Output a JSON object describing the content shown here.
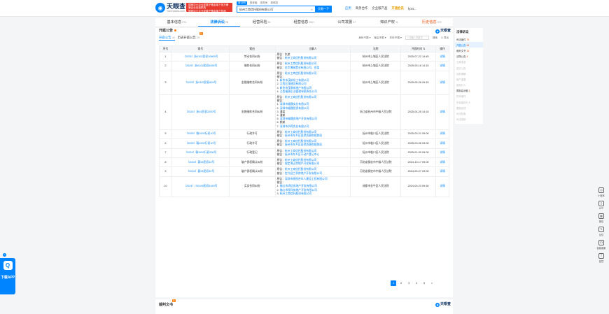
{
  "header": {
    "logo_text": "天眼查",
    "logo_sub": "TianYancha.com",
    "promo_line1": "国家中小企业发展子基金旗下官方备案企业征信机构",
    "promo_line2": "国家中小企业发展子基金旗下机构",
    "search_tabs": [
      "查公司",
      "查老板",
      "查关系",
      "查风险"
    ],
    "search_value": "杭州工商信托股份有限公司",
    "search_button": "天眼一下",
    "nav": [
      "应用",
      "商务合作",
      "企业版产品",
      "开通会员",
      "fyx4..."
    ]
  },
  "tabs": [
    {
      "label": "基本信息",
      "count": "274"
    },
    {
      "label": "法律诉讼",
      "count": "79"
    },
    {
      "label": "经营风险",
      "count": "81"
    },
    {
      "label": "经营信息",
      "count": "999+"
    },
    {
      "label": "公司发展",
      "count": "37"
    },
    {
      "label": "知识产权",
      "count": "11"
    },
    {
      "label": "历史信息",
      "count": "379"
    }
  ],
  "section": {
    "title": "开庭公告",
    "brand": "天眼查",
    "subtabs": [
      {
        "label": "开庭公告",
        "count": "44"
      },
      {
        "label": "历史开庭公告",
        "count": "29"
      }
    ],
    "new_badge": "新",
    "filters": [
      "身份不限",
      "案由不限",
      "年份不限"
    ],
    "search_placeholder": "请输入关键词",
    "search_btn": "搜索",
    "export": "导出"
  },
  "table": {
    "headers": [
      "序号",
      "案号",
      "案由",
      "当事人",
      "法院",
      "开庭时间",
      "操作"
    ],
    "rows": [
      {
        "no": "1",
        "case_no": "（2025）浙0102民初10805号",
        "cause": "劳动合同纠纷",
        "parties": [
          [
            "原告：",
            "仇某",
            "plain"
          ],
          [
            "被告：",
            "杭州工商信托股份有限公司",
            "link"
          ]
        ],
        "court": "杭州市上城区人民法院",
        "time": "2025-07-22 14:45",
        "op": "详情"
      },
      {
        "no": "2",
        "case_no": "（2025）浙0102民初5455号",
        "cause": "借款合同纠纷",
        "parties": [
          [
            "原告：",
            "杭州工商信托股份有限公司",
            "link"
          ],
          [
            "被告：",
            "金华博瑞置业有限公司，徐某",
            "link"
          ]
        ],
        "court": "杭州市上城区人民法院",
        "time": "2025-05-16 14:15",
        "op": "详情"
      },
      {
        "no": "3",
        "case_no": "（2025）浙0102民初824号",
        "cause": "金融借款合同纠纷",
        "parties": [
          [
            "原告：",
            "杭州工商信托股份有限公司",
            "link"
          ],
          [
            "被告：",
            "",
            "plain"
          ],
          [
            "1. ",
            "新余市茂新化工有限公司",
            "link"
          ],
          [
            "2. ",
            "江西红茂建设有限公司",
            "link"
          ],
          [
            "3. ",
            "新余市茂源房地产有限公司",
            "link"
          ],
          [
            "4. ",
            "江西福源企业管理有限责任公司",
            "link"
          ]
        ],
        "court": "杭州市上城区人民法院",
        "time": "2025-05-26 09:15",
        "op": "详情"
      },
      {
        "no": "4",
        "case_no": "（2024）浙01民初2200号",
        "cause": "金融借款合同纠纷",
        "parties": [
          [
            "原告：",
            "杭州工商信托股份有限公司",
            "link"
          ],
          [
            "被告：",
            "",
            "plain"
          ],
          [
            "1. ",
            "深圳市福晟实业有限公司",
            "link"
          ],
          [
            "2. ",
            "深圳市福晟投资有限公司",
            "link"
          ],
          [
            "3. ",
            "潘某",
            "plain"
          ],
          [
            "4. ",
            "潘某",
            "plain"
          ],
          [
            "5. ",
            "深圳市福晟房地产开发有限公司",
            "link"
          ],
          [
            "6. ",
            "颜某",
            "plain"
          ],
          [
            "7. ",
            "深圳市洪荷实业有限公司",
            "link"
          ]
        ],
        "court": "浙江省杭州市中级人民法院",
        "time": "2025-04-25 14:15",
        "op": "详情"
      },
      {
        "no": "5",
        "case_no": "（2025）赣1002行初10号",
        "cause": "行政许可",
        "parties": [
          [
            "原告：",
            "杭州工商信托股份有限公司",
            "link"
          ],
          [
            "被告：",
            "抚州市东乡区自然资源和规划局",
            "link"
          ]
        ],
        "court": "抚州市临川区人民法院",
        "time": "2025-03-21 09:00",
        "op": "详情"
      },
      {
        "no": "6",
        "case_no": "（2025）赣1002行初10号",
        "cause": "行政许可",
        "parties": [
          [
            "原告：",
            "杭州工商信托股份有限公司",
            "link"
          ],
          [
            "被告：",
            "抚州市东乡区自然资源和规划局",
            "link"
          ]
        ],
        "court": "抚州市临川区人民法院",
        "time": "2025-03-06 09:00",
        "op": "详情"
      },
      {
        "no": "7",
        "case_no": "（2024）赣1002行初206号",
        "cause": "行政登记",
        "parties": [
          [
            "原告：",
            "杭州工商信托股份有限公司",
            "link"
          ],
          [
            "被告：",
            "抚州市东乡区不动产登记中心",
            "link"
          ]
        ],
        "court": "抚州市临川区人民法院",
        "time": "2025-01-09 09:00",
        "op": "详情"
      },
      {
        "no": "8",
        "case_no": "（2024）冀06民初43号",
        "cause": "破产债权确认纠纷",
        "parties": [
          [
            "原告：",
            "杭州工商信托股份有限公司",
            "link"
          ],
          [
            "被告：",
            "保定海正房地产开发有限公司",
            "link"
          ]
        ],
        "court": "河北省保定市中级人民法院",
        "time": "2024-10-17 09:00",
        "op": "详情"
      },
      {
        "no": "9",
        "case_no": "（2024）冀06民初42号",
        "cause": "破产债权确认纠纷",
        "parties": [
          [
            "原告：",
            "杭州工商信托股份有限公司",
            "link"
          ],
          [
            "被告：",
            "定兴县兰亭房地产开发有限公司",
            "link"
          ]
        ],
        "court": "河北省保定市中级人民法院",
        "time": "2024-09-27 09:00",
        "op": "详情"
      },
      {
        "no": "10",
        "case_no": "（2024）川0106民初9163号",
        "cause": "买卖合同纠纷",
        "parties": [
          [
            "原告：",
            "深圳市桃悦合伙人建设工程有限公司",
            "link"
          ],
          [
            "被告：",
            "",
            "plain"
          ],
          [
            "1. ",
            "佛山市鸿信房地产开发有限公司",
            "link"
          ],
          [
            "2. ",
            "佛山市锐洋房地产开发有限公司",
            "link"
          ],
          [
            "3. ",
            "杭州工商信托股份有限公司",
            "link"
          ]
        ],
        "court": "成都市金牛区人民法院",
        "time": "2024-09-23 09:30",
        "op": "详情"
      }
    ]
  },
  "pager": [
    "1",
    "2",
    "3",
    "4",
    "5",
    ">"
  ],
  "section2": {
    "title": "裁判文书",
    "new_badge": "新",
    "brand": "天眼查"
  },
  "sidebar": {
    "title": "法律诉讼",
    "items": [
      {
        "label": "司法案件",
        "count": "79"
      },
      {
        "label": "开庭公告",
        "count": "44"
      },
      {
        "label": "裁判文书",
        "count": "14"
      },
      {
        "label": "法院公告",
        "count": "4"
      },
      {
        "label": "立案信息",
        "count": ""
      },
      {
        "label": "送达公告",
        "count": ""
      },
      {
        "label": "诉前调解",
        "count": ""
      },
      {
        "label": "破产重整",
        "count": ""
      },
      {
        "label": "被执行人",
        "count": ""
      },
      {
        "label": "限制高消费",
        "count": "1"
      },
      {
        "label": "终本案件",
        "count": ""
      },
      {
        "label": "失信被执行人",
        "count": ""
      },
      {
        "label": "限制出境",
        "count": ""
      },
      {
        "label": "司法拍卖",
        "count": ""
      },
      {
        "label": "司法协助",
        "count": ""
      }
    ]
  },
  "tools": [
    "小程序",
    "APP",
    "微信",
    "反馈",
    "智能客服",
    "回顶"
  ],
  "download": {
    "label": "下载APP",
    "icon_letter": "Q"
  }
}
